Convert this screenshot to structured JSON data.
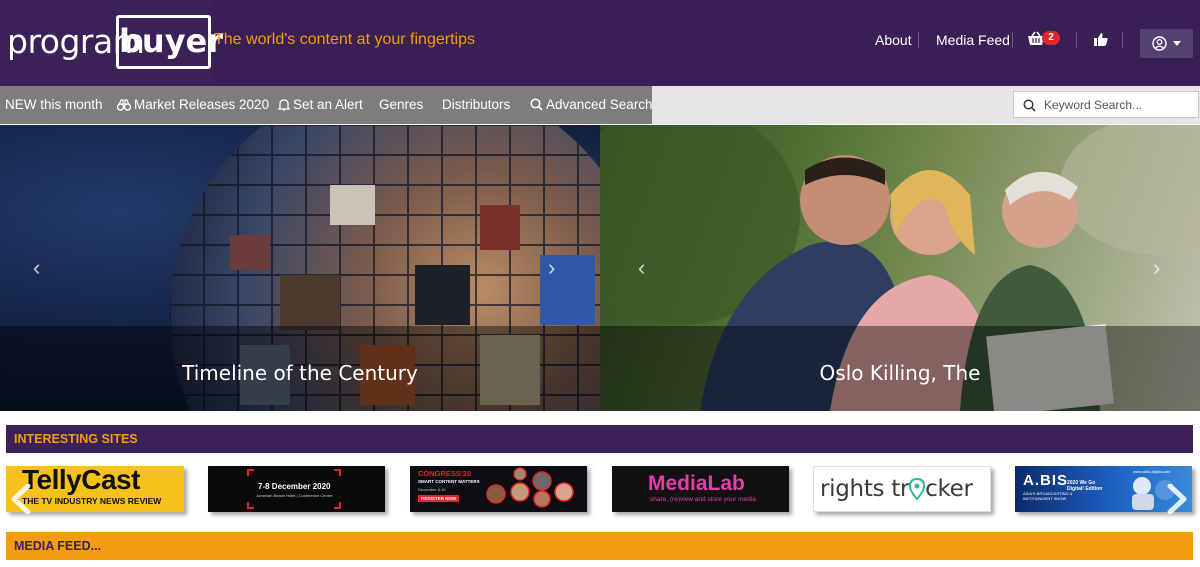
{
  "header": {
    "logo_left": "program",
    "logo_right": "buyer",
    "tagline": "The world's content at your fingertips",
    "nav": [
      "About",
      "Media Feed"
    ],
    "basket_count": "2",
    "accent": "#f39c12",
    "brand": "#3b2157"
  },
  "navbar": {
    "items": [
      {
        "label": "NEW this month",
        "icon": ""
      },
      {
        "label": "Market Releases 2020",
        "icon": "binoculars-icon"
      },
      {
        "label": "Set an Alert",
        "icon": "bell-icon"
      },
      {
        "label": "Genres",
        "icon": ""
      },
      {
        "label": "Distributors",
        "icon": ""
      },
      {
        "label": "Advanced Search",
        "icon": "search-icon"
      }
    ],
    "search_placeholder": "Keyword Search..."
  },
  "carousel": {
    "slides": [
      {
        "caption": "Timeline of the Century"
      },
      {
        "caption": "Oslo Killing, The"
      }
    ]
  },
  "sections": {
    "sites_title": "INTERESTING SITES",
    "media_title": "MEDIA FEED..."
  },
  "sites": {
    "tellycast_title": "TellyCast",
    "tellycast_sub": "THE TV INDUSTRY NEWS REVIEW",
    "dec_title": "7-8 December 2020",
    "dec_sub": "Jumeirah Beach Hotel | Conference Centre",
    "congress_title": "CONGRESS'20",
    "congress_sub": "SMART CONTENT MATTERS",
    "congress_date": "December 8-10",
    "congress_btn": "REGISTER NOW",
    "medialab_title": "MediaLab",
    "medialab_sub": "share, (re)view and store your media",
    "rights_left": "rights tr",
    "rights_right": "cker",
    "abis_title": "A.BIS",
    "abis_sub": "ASIA'S BROADCASTING & INFOTAINMENT SHOW",
    "abis_edition": "2020 We Go Digital! Edition",
    "abis_url": "www.abis-digital.com"
  }
}
